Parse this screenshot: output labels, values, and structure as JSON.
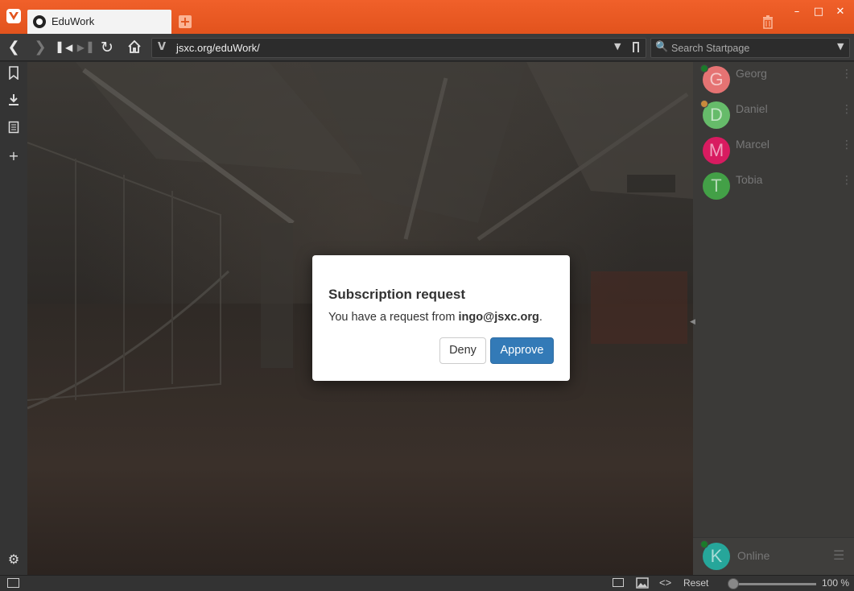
{
  "browser": {
    "tab_title": "EduWork",
    "url": "jsxc.org/eduWork/",
    "search_placeholder": "Search Startpage",
    "zoom": "100 %",
    "reset_label": "Reset"
  },
  "dialog": {
    "title": "Subscription request",
    "text_prefix": "You have a request from ",
    "requester": "ingo@jsxc.org",
    "text_suffix": ".",
    "deny_label": "Deny",
    "approve_label": "Approve"
  },
  "roster": {
    "contacts": [
      {
        "initial": "G",
        "name": "Georg",
        "color": "#e57373",
        "status_color": "#1b7a2a"
      },
      {
        "initial": "D",
        "name": "Daniel",
        "color": "#66bb6a",
        "status_color": "#c98a3c"
      },
      {
        "initial": "M",
        "name": "Marcel",
        "color": "#d81b60",
        "status_color": ""
      },
      {
        "initial": "T",
        "name": "Tobia",
        "color": "#43a047",
        "status_color": ""
      }
    ],
    "self": {
      "initial": "K",
      "status": "Online",
      "color": "#26a69a",
      "status_color": "#1b7a2a"
    }
  },
  "colors": {
    "accent": "#e2531d",
    "approve": "#337ab7"
  },
  "icons": [
    "back-icon",
    "forward-icon",
    "rewind-icon",
    "fast-forward-icon",
    "reload-icon",
    "home-icon",
    "bookmark-icon",
    "download-icon",
    "notes-icon",
    "add-panel-icon",
    "settings-icon",
    "trash-icon",
    "search-icon"
  ]
}
